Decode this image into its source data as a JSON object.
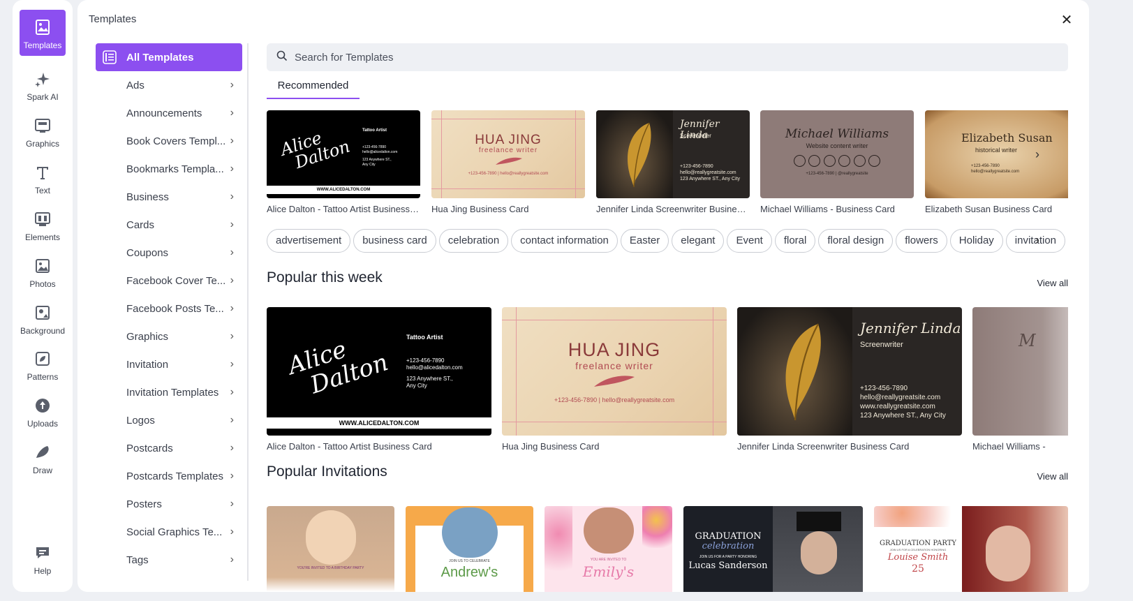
{
  "rail": {
    "items": [
      {
        "label": "Templates",
        "icon": "templates-icon"
      },
      {
        "label": "Spark AI",
        "icon": "sparkle-icon"
      },
      {
        "label": "Graphics",
        "icon": "graphics-icon"
      },
      {
        "label": "Text",
        "icon": "text-icon"
      },
      {
        "label": "Elements",
        "icon": "elements-icon"
      },
      {
        "label": "Photos",
        "icon": "photos-icon"
      },
      {
        "label": "Background",
        "icon": "background-icon"
      },
      {
        "label": "Patterns",
        "icon": "patterns-icon"
      },
      {
        "label": "Uploads",
        "icon": "uploads-icon"
      },
      {
        "label": "Draw",
        "icon": "draw-icon"
      },
      {
        "label": "Help",
        "icon": "help-icon"
      }
    ]
  },
  "panel": {
    "title": "Templates",
    "close_icon": "close-icon"
  },
  "categories": [
    "All Templates",
    "Ads",
    "Announcements",
    "Book Covers Templ...",
    "Bookmarks Templa...",
    "Business",
    "Cards",
    "Coupons",
    "Facebook Cover Te...",
    "Facebook Posts Te...",
    "Graphics",
    "Invitation",
    "Invitation Templates",
    "Logos",
    "Postcards",
    "Postcards Templates",
    "Posters",
    "Social Graphics Te...",
    "Tags"
  ],
  "search": {
    "placeholder": "Search for Templates"
  },
  "tabs": {
    "recommended": "Recommended"
  },
  "recommended": [
    {
      "caption": "Alice Dalton - Tattoo Artist Business C...",
      "name1": "Alice",
      "name2": "Dalton",
      "role": "Tattoo Artist",
      "phone": "+123-456-7890",
      "email": "hello@alicedalton.com",
      "addr1": "123 Anywhere ST.,",
      "addr2": "Any City",
      "url": "WWW.ALICEDALTON.COM"
    },
    {
      "caption": "Hua Jing Business Card",
      "name": "HUA JING",
      "role": "freelance writer",
      "contact": "+123-456-7890 | hello@reallygreatsite.com"
    },
    {
      "caption": "Jennifer Linda Screenwriter Business ...",
      "name": "Jennifer Linda",
      "role": "Screenwriter",
      "phone": "+123-456-7890",
      "email": "hello@reallygreatsite.com",
      "addr": "123 Anywhere ST., Any City"
    },
    {
      "caption": "Michael Williams - Business Card",
      "name": "Michael Williams",
      "role": "Website content writer",
      "contact": "+123-456-7890 | @reallygreatsite"
    },
    {
      "caption": "Elizabeth Susan Business Card",
      "name": "Elizabeth Susan",
      "role": "historical writer",
      "phone": "+123-456-7890",
      "email": "hello@reallygreatsite.com"
    }
  ],
  "tags": [
    "advertisement",
    "business card",
    "celebration",
    "contact information",
    "Easter",
    "elegant",
    "Event",
    "floral",
    "floral design",
    "flowers",
    "Holiday",
    "invitation"
  ],
  "popular_week": {
    "title": "Popular this week",
    "view_all": "View all",
    "items": [
      {
        "caption": "Alice Dalton - Tattoo Artist Business Card",
        "name1": "Alice",
        "name2": "Dalton",
        "role": "Tattoo Artist",
        "phone": "+123-456-7890",
        "email": "hello@alicedalton.com",
        "addr1": "123 Anywhere ST.,",
        "addr2": "Any City",
        "url": "WWW.ALICEDALTON.COM"
      },
      {
        "caption": "Hua Jing Business Card",
        "name": "HUA JING",
        "role": "freelance writer",
        "contact": "+123-456-7890 | hello@reallygreatsite.com"
      },
      {
        "caption": "Jennifer Linda Screenwriter Business Card",
        "name": "Jennifer Linda",
        "role": "Screenwriter",
        "phone": "+123-456-7890",
        "email": "hello@reallygreatsite.com",
        "web": "www.reallygreatsite.com",
        "addr": "123 Anywhere ST., Any City"
      },
      {
        "caption": "Michael Williams -",
        "name": "M"
      }
    ]
  },
  "popular_invitations": {
    "title": "Popular Invitations",
    "view_all": "View all",
    "items": [
      {
        "line1": "YOU'RE INVITED TO A BIRTHDAY PARTY"
      },
      {
        "line1": "JOIN US TO CELEBRATE",
        "name": "Andrew's"
      },
      {
        "line1": "YOU ARE INVITED TO",
        "name": "Emily's"
      },
      {
        "title": "GRADUATION",
        "script": "celebration",
        "line1": "JOIN US FOR A PARTY HONORING",
        "name": "Lucas Sanderson"
      },
      {
        "title": "GRADUATION PARTY",
        "line1": "JOIN US FOR A CELEBRATION HONORING",
        "name": "Louise Smith",
        "num": "25"
      }
    ]
  },
  "colors": {
    "accent": "#8c4ff0",
    "background": "#eef0f4"
  }
}
